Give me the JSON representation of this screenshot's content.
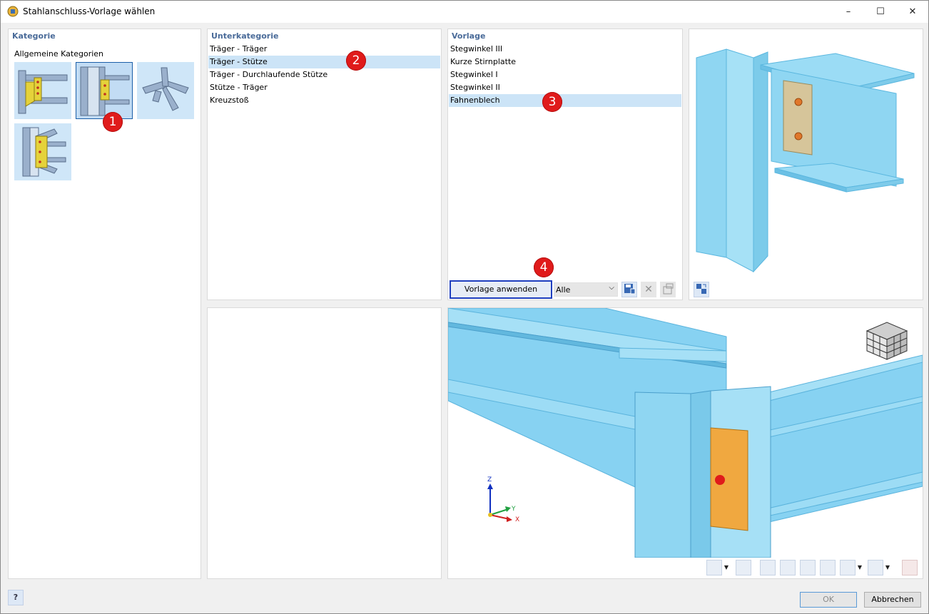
{
  "window": {
    "title": "Stahlanschluss-Vorlage wählen",
    "minimize": "–",
    "maximize": "☐",
    "close": "✕"
  },
  "kategorie": {
    "header": "Kategorie",
    "group_label": "Allgemeine Kategorien",
    "thumbnails": [
      {
        "name": "category-thumb-1",
        "selected": false
      },
      {
        "name": "category-thumb-2",
        "selected": true
      },
      {
        "name": "category-thumb-3",
        "selected": false
      },
      {
        "name": "category-thumb-4",
        "selected": false
      }
    ]
  },
  "unterkategorie": {
    "header": "Unterkategorie",
    "items": [
      "Träger - Träger",
      "Träger - Stütze",
      "Träger - Durchlaufende Stütze",
      "Stütze - Träger",
      "Kreuzstoß"
    ],
    "selected_index": 1
  },
  "vorlage": {
    "header": "Vorlage",
    "items": [
      "Stegwinkel III",
      "Kurze Stirnplatte",
      "Stegwinkel I",
      "Stegwinkel II",
      "Fahnenblech"
    ],
    "selected_index": 4,
    "apply_button": "Vorlage anwenden",
    "filter_value": "Alle"
  },
  "badges": [
    "1",
    "2",
    "3",
    "4"
  ],
  "axes": {
    "z": "Z",
    "y": "Y",
    "x": "X"
  },
  "footer": {
    "ok": "OK",
    "cancel": "Abbrechen"
  },
  "colors": {
    "steel": "#86d3f2",
    "plate": "#f0a840",
    "bolt": "#e01b1b",
    "accent": "#4a6b99",
    "selection": "#cce4f7"
  }
}
